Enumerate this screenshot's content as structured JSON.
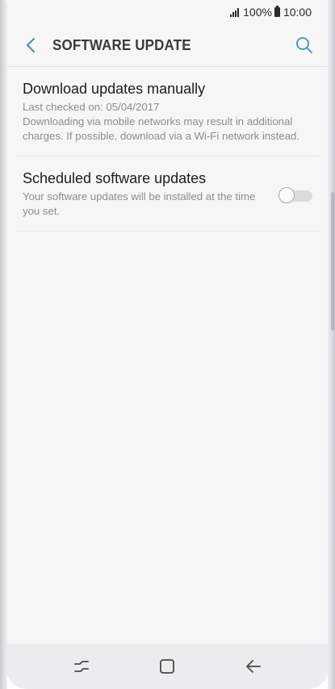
{
  "status_bar": {
    "battery_percent": "100%",
    "time": "10:00",
    "icons": [
      "signal-icon",
      "battery-icon"
    ]
  },
  "app_bar": {
    "title": "SOFTWARE UPDATE",
    "back_icon": "chevron-left-icon",
    "search_icon": "search-icon",
    "accent_color": "#3e91b5"
  },
  "items": [
    {
      "title": "Download updates manually",
      "lines": [
        "Last checked on: 05/04/2017",
        "Downloading via mobile networks may result in additional charges. If possible, download via a Wi-Fi network instead."
      ]
    },
    {
      "title": "Scheduled software updates",
      "lines": [
        "Your software updates will be installed at the time you set."
      ],
      "toggle_on": false
    }
  ],
  "nav_bar": {
    "icons": [
      "recent-apps-icon",
      "home-icon",
      "back-icon"
    ]
  }
}
